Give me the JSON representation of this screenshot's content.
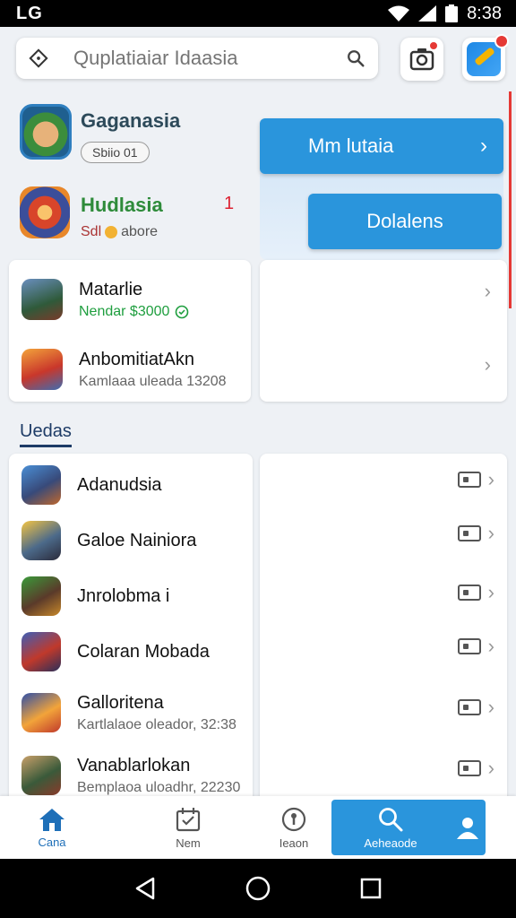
{
  "status_bar": {
    "brand": "LG",
    "time": "8:38"
  },
  "search": {
    "placeholder": "Quplatiaiar Idaasia"
  },
  "featured": [
    {
      "title": "Gaganasia",
      "badge": "Sbiio 01"
    },
    {
      "title": "Hudlasia",
      "count": "1",
      "subtitle_prefix": "Sdl",
      "subtitle": "abore"
    }
  ],
  "actions": {
    "primary": "Mm lutaia",
    "secondary": "Dolalens"
  },
  "top_list": [
    {
      "name": "Matarlie",
      "sub": "Nendar $3000"
    },
    {
      "name": "AnbomitiatAkn",
      "sub": "Kamlaaa uleada 13208"
    }
  ],
  "section": {
    "label": "Uedas"
  },
  "list": [
    {
      "name": "Adanudsia",
      "sub": ""
    },
    {
      "name": "Galoe Nainiora",
      "sub": ""
    },
    {
      "name": "Jnrolobma i",
      "sub": ""
    },
    {
      "name": "Colaran Mobada",
      "sub": ""
    },
    {
      "name": "Galloritena",
      "sub": "Kartlalaoe oleador, 32:38"
    },
    {
      "name": "Vanablarlokan",
      "sub": "Bemplaoa uloadhr, 22230"
    }
  ],
  "nav": [
    {
      "label": "Cana"
    },
    {
      "label": "Nem"
    },
    {
      "label": "Ieaon"
    },
    {
      "label": "Aeheaode"
    }
  ],
  "colors": {
    "accent": "#2a95dc",
    "green": "#1e9e3e",
    "alert": "#e53935"
  }
}
